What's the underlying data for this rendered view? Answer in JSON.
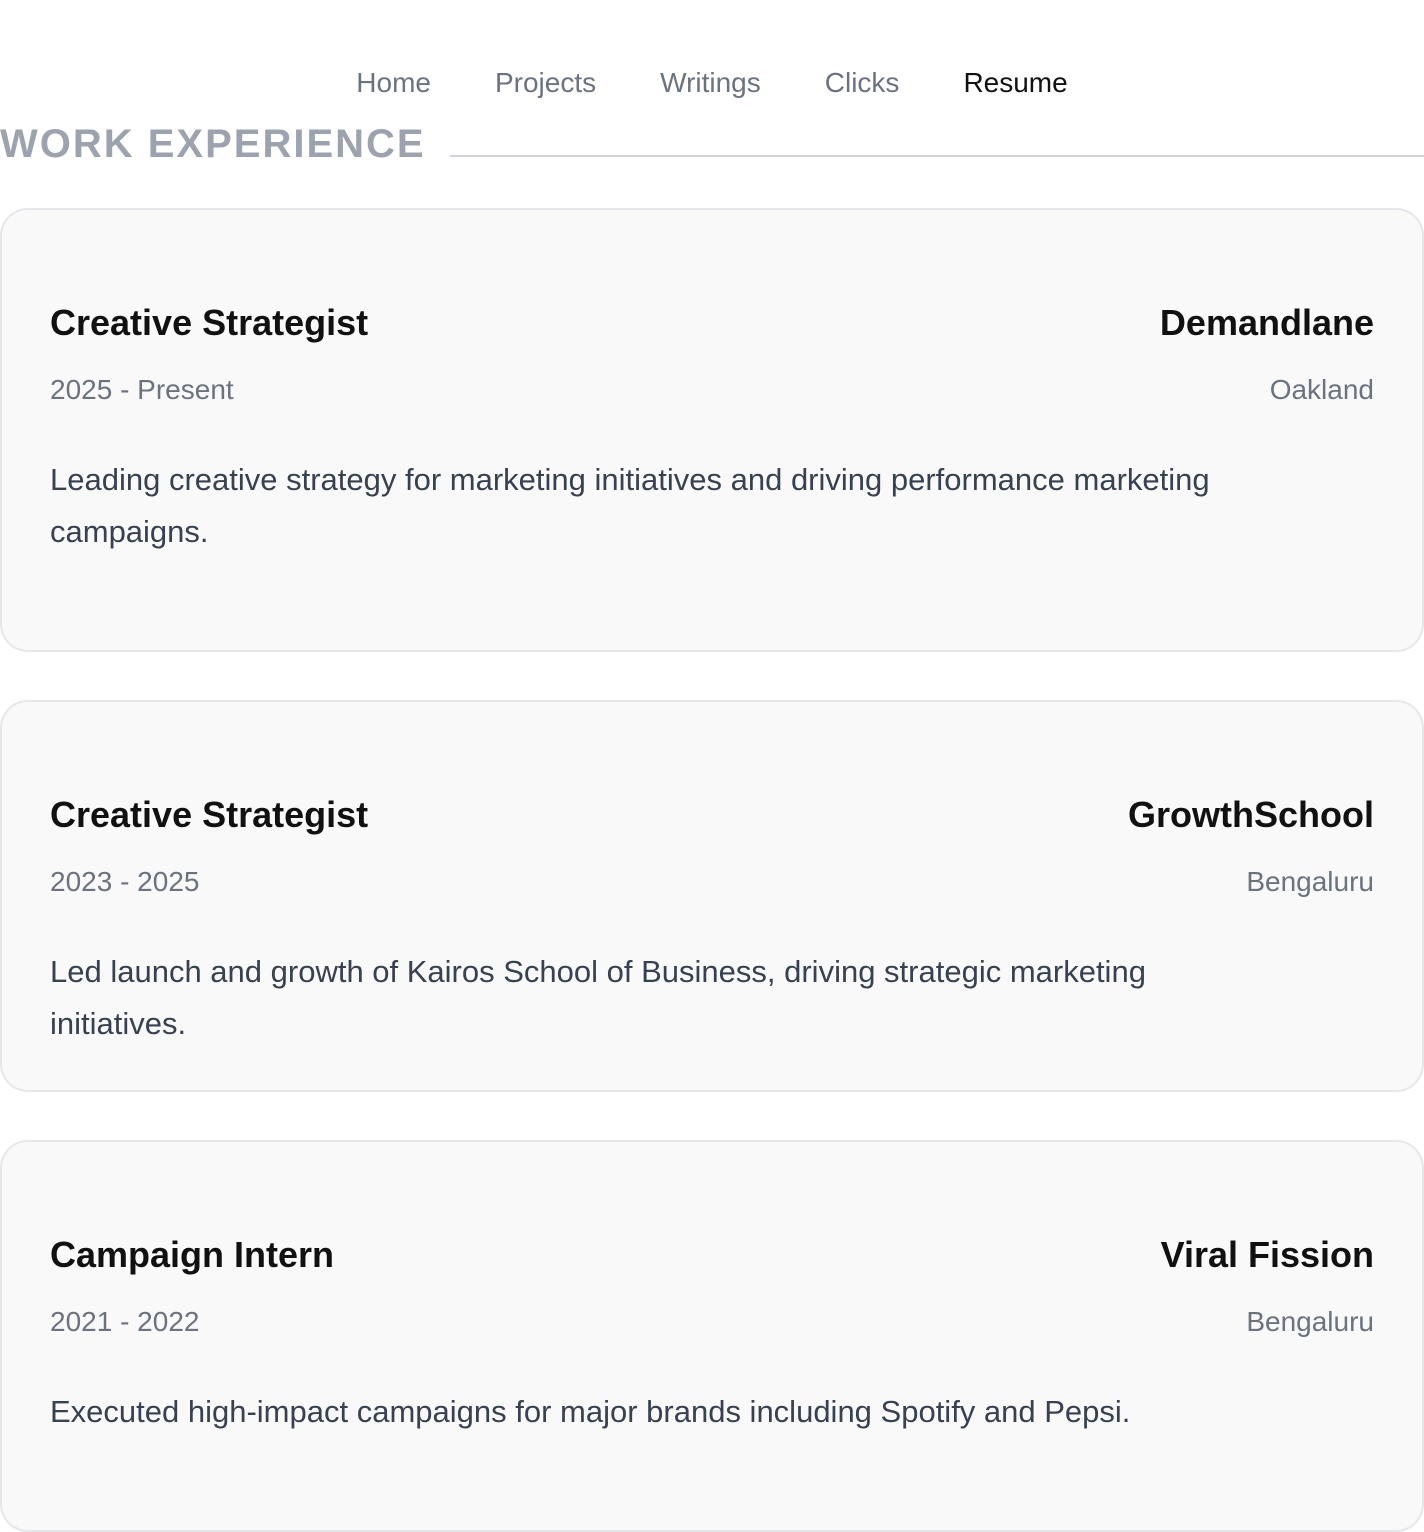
{
  "nav": {
    "items": [
      {
        "label": "Home",
        "active": false
      },
      {
        "label": "Projects",
        "active": false
      },
      {
        "label": "Writings",
        "active": false
      },
      {
        "label": "Clicks",
        "active": false
      },
      {
        "label": "Resume",
        "active": true
      }
    ]
  },
  "section": {
    "title": "WORK EXPERIENCE"
  },
  "jobs": [
    {
      "role": "Creative Strategist",
      "company": "Demandlane",
      "dates": "2025 - Present",
      "location": "Oakland",
      "description": "Leading creative strategy for marketing initiatives and driving performance marketing campaigns."
    },
    {
      "role": "Creative Strategist",
      "company": "GrowthSchool",
      "dates": "2023 - 2025",
      "location": "Bengaluru",
      "description": "Led launch and growth of Kairos School of Business, driving strategic marketing initiatives."
    },
    {
      "role": "Campaign Intern",
      "company": "Viral Fission",
      "dates": "2021 - 2022",
      "location": "Bengaluru",
      "description": "Executed high-impact campaigns for major brands including Spotify and Pepsi."
    }
  ],
  "colors": {
    "nav_inactive": "#6b7280",
    "nav_active": "#111111",
    "section_title": "#9ca3af",
    "card_bg": "#f9f9f9",
    "card_border": "#e5e7eb"
  }
}
